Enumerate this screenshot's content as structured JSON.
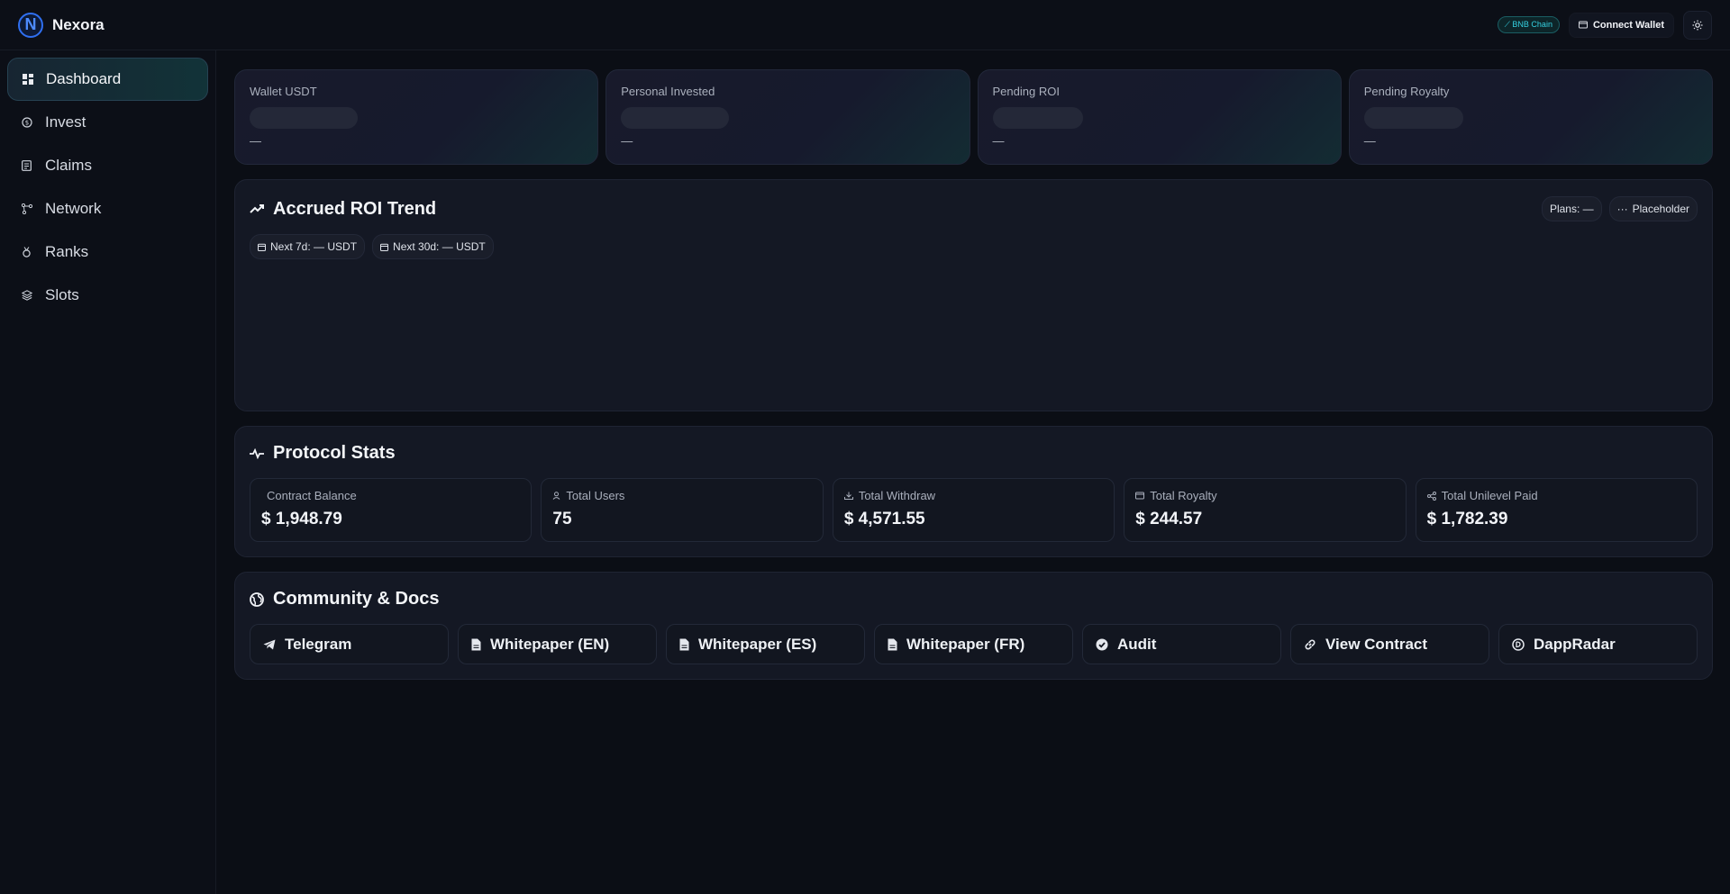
{
  "header": {
    "logo_letter": "N",
    "brand": "Nexora",
    "chain_badge": "BNB Chain",
    "connect_label": "Connect Wallet"
  },
  "sidebar": {
    "items": [
      {
        "label": "Dashboard",
        "icon": "grid-icon",
        "active": true
      },
      {
        "label": "Invest",
        "icon": "coin-icon"
      },
      {
        "label": "Claims",
        "icon": "receipt-icon"
      },
      {
        "label": "Network",
        "icon": "network-icon"
      },
      {
        "label": "Ranks",
        "icon": "medal-icon"
      },
      {
        "label": "Slots",
        "icon": "layers-icon"
      }
    ]
  },
  "summary_cards": [
    {
      "label": "Wallet USDT",
      "value": "—"
    },
    {
      "label": "Personal Invested",
      "value": "—"
    },
    {
      "label": "Pending ROI",
      "value": "—"
    },
    {
      "label": "Pending Royalty",
      "value": "—"
    }
  ],
  "roi": {
    "title": "Accrued ROI Trend",
    "plans_pill": "Plans: —",
    "placeholder_pill": "Placeholder",
    "next7": "Next 7d: — USDT",
    "next30": "Next 30d: — USDT"
  },
  "protocol": {
    "title": "Protocol Stats",
    "stats": [
      {
        "label": "Contract Balance",
        "value": "$ 1,948.79"
      },
      {
        "label": "Total Users",
        "value": "75",
        "icon": "user-icon"
      },
      {
        "label": "Total Withdraw",
        "value": "$ 4,571.55",
        "icon": "download-icon"
      },
      {
        "label": "Total Royalty",
        "value": "$ 244.57",
        "icon": "wallet-icon"
      },
      {
        "label": "Total Unilevel Paid",
        "value": "$ 1,782.39",
        "icon": "share-icon"
      }
    ]
  },
  "community": {
    "title": "Community & Docs",
    "links": [
      {
        "label": "Telegram",
        "icon": "telegram-icon"
      },
      {
        "label": "Whitepaper (EN)",
        "icon": "document-icon"
      },
      {
        "label": "Whitepaper (ES)",
        "icon": "document-icon"
      },
      {
        "label": "Whitepaper (FR)",
        "icon": "document-icon"
      },
      {
        "label": "Audit",
        "icon": "check-badge-icon"
      },
      {
        "label": "View Contract",
        "icon": "link-icon"
      },
      {
        "label": "DappRadar",
        "icon": "radar-icon"
      }
    ]
  },
  "colors": {
    "accent": "#2f6ff0",
    "teal": "#35d0e0",
    "background": "#0b0e15"
  }
}
